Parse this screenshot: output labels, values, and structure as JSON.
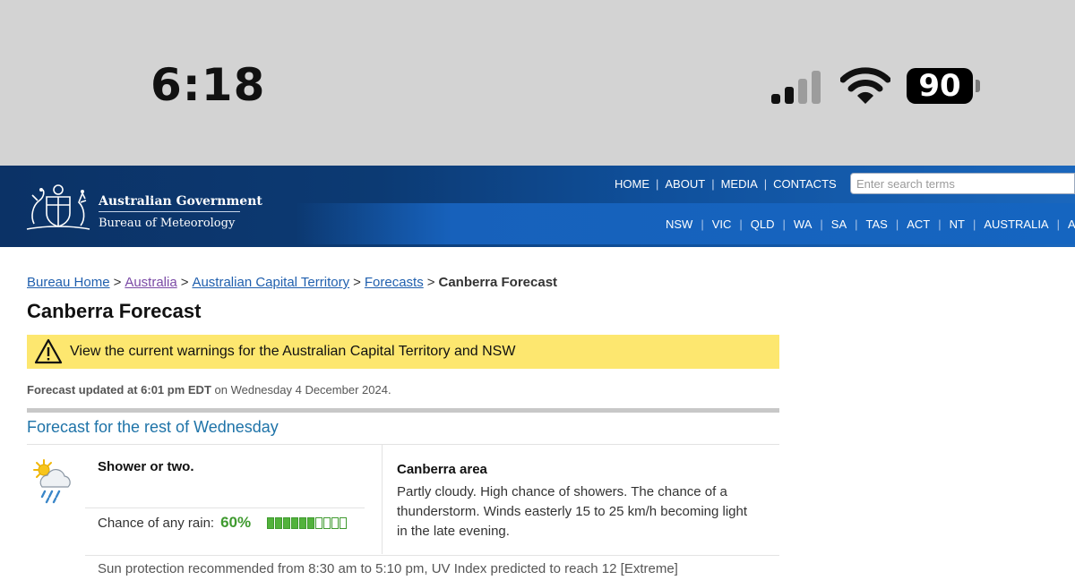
{
  "status_bar": {
    "time": "6:18",
    "battery": "90",
    "icons": [
      "cellular-signal-icon",
      "wifi-icon",
      "battery-icon"
    ]
  },
  "header": {
    "gov_name": "Australian Government",
    "bureau_name": "Bureau of Meteorology",
    "logo_icon": "coat-of-arms-icon",
    "top_nav": [
      "HOME",
      "ABOUT",
      "MEDIA",
      "CONTACTS"
    ],
    "search_placeholder": "Enter search terms",
    "region_nav": [
      "NSW",
      "VIC",
      "QLD",
      "WA",
      "SA",
      "TAS",
      "ACT",
      "NT",
      "AUSTRALIA",
      "AI"
    ]
  },
  "breadcrumb": {
    "items": [
      "Bureau Home",
      "Australia",
      "Australian Capital Territory",
      "Forecasts"
    ],
    "separator": ">",
    "current": "Canberra Forecast"
  },
  "page": {
    "title": "Canberra Forecast"
  },
  "warning": {
    "text": "View the current warnings for the Australian Capital Territory and NSW",
    "background": "#fde76f",
    "icon": "warning-triangle-icon"
  },
  "updated": {
    "label": "Forecast updated at 6:01 pm EDT",
    "date": " on Wednesday 4 December 2024."
  },
  "forecast": {
    "section_title": "Forecast for the rest of Wednesday",
    "summary": "Shower or two.",
    "icon": "shower-cloud-sun-icon",
    "rain_label": "Chance of any rain:",
    "rain_chance": "60%",
    "rain_chance_fraction": 0.6,
    "rain_segments_total": 10,
    "area_title": "Canberra area",
    "area_text": "Partly cloudy. High chance of showers. The chance of a thunderstorm. Winds easterly 15 to 25 km/h becoming light in the late evening.",
    "uv_text": "Sun protection recommended from 8:30 am to 5:10 pm, UV Index predicted to reach 12 [Extreme]",
    "rain_color": "#3f9a2f"
  }
}
